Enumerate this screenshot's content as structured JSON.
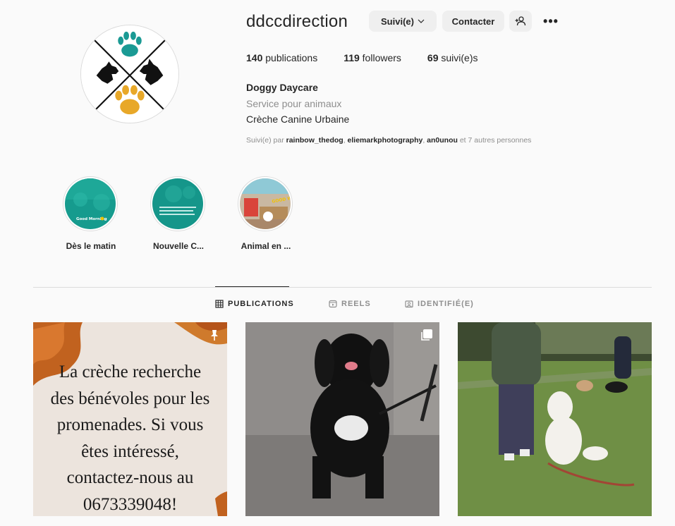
{
  "profile": {
    "username": "ddccdirection",
    "full_name": "Doggy Daycare",
    "category": "Service pour animaux",
    "bio": "Crèche Canine Urbaine"
  },
  "actions": {
    "following_label": "Suivi(e)",
    "contact_label": "Contacter",
    "more_label": "•••"
  },
  "stats": {
    "posts_count": "140",
    "posts_label": "publications",
    "followers_count": "119",
    "followers_label": "followers",
    "following_count": "69",
    "following_label": "suivi(e)s"
  },
  "followed_by": {
    "prefix": "Suivi(e) par",
    "names": [
      "rainbow_thedog",
      "eliemarkphotography",
      "an0unou"
    ],
    "suffix": "et 7 autres personnes"
  },
  "highlights": [
    {
      "label": "Dès le matin",
      "caption": "Good Morning"
    },
    {
      "label": "Nouvelle C..."
    },
    {
      "label": "Animal en ...",
      "caption": "GOOD WORK"
    }
  ],
  "tabs": [
    {
      "label": "PUBLICATIONS",
      "icon": "grid-icon",
      "active": true
    },
    {
      "label": "REELS",
      "icon": "reels-icon",
      "active": false
    },
    {
      "label": "IDENTIFIÉ(E)",
      "icon": "tagged-icon",
      "active": false
    }
  ],
  "posts": [
    {
      "type": "text-image",
      "pinned": true,
      "lines": [
        "La crèche recherche",
        "des bénévoles pour les",
        "promenades. Si vous",
        "êtes intéressé,",
        "contactez-nous au",
        "0673339048!"
      ]
    },
    {
      "type": "photo",
      "multi": true
    },
    {
      "type": "photo"
    }
  ],
  "colors": {
    "background": "#fafafa",
    "button_bg": "#efefef",
    "text_primary": "#262626",
    "text_secondary": "#8e8e8e",
    "logo_teal": "#1a9a94",
    "logo_gold": "#e8a829"
  }
}
